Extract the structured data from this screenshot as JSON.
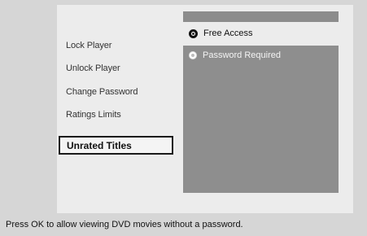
{
  "menu": {
    "items": [
      {
        "label": "Lock Player"
      },
      {
        "label": "Unlock Player"
      },
      {
        "label": "Change Password"
      },
      {
        "label": "Ratings Limits"
      },
      {
        "label": "Unrated Titles"
      }
    ]
  },
  "options": [
    {
      "label": "Free Access",
      "selected": true
    },
    {
      "label": "Password Required",
      "selected": false
    }
  ],
  "status": {
    "text": "Press OK to allow viewing DVD movies without a password."
  },
  "colors": {
    "background": "#d6d6d6",
    "panel": "#ececec",
    "options_box": "#8e8e8e"
  }
}
